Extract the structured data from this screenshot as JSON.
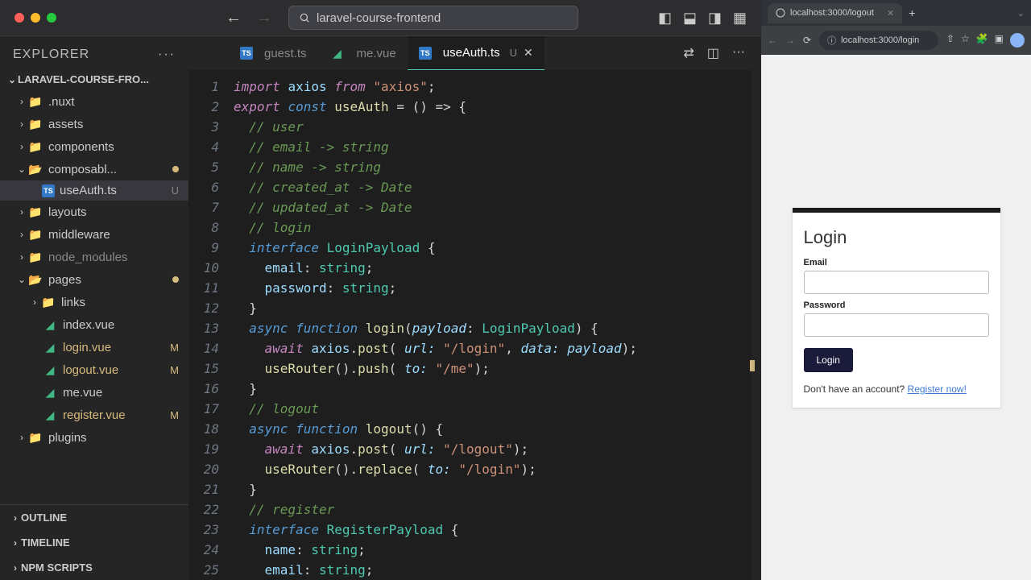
{
  "titlebar": {
    "project": "laravel-course-frontend"
  },
  "explorer": {
    "title": "EXPLORER",
    "project": "LARAVEL-COURSE-FRO...",
    "tree": {
      "nuxt": ".nuxt",
      "assets": "assets",
      "components": "components",
      "composables": "composabl...",
      "useAuth": "useAuth.ts",
      "useAuth_badge": "U",
      "layouts": "layouts",
      "middleware": "middleware",
      "node_modules": "node_modules",
      "pages": "pages",
      "links": "links",
      "index_vue": "index.vue",
      "login_vue": "login.vue",
      "logout_vue": "logout.vue",
      "me_vue": "me.vue",
      "register_vue": "register.vue",
      "plugins": "plugins",
      "m": "M"
    },
    "outline": "OUTLINE",
    "timeline": "TIMELINE",
    "npm": "NPM SCRIPTS"
  },
  "tabs": {
    "guest": "guest.ts",
    "me": "me.vue",
    "useAuth": "useAuth.ts",
    "u": "U"
  },
  "code": {
    "l1a": "import",
    "l1b": "axios",
    "l1c": "from",
    "l1d": "\"axios\"",
    "l1e": ";",
    "l2a": "export",
    "l2b": "const",
    "l2c": "useAuth",
    "l2d": " = () => {",
    "l3": "// user",
    "l4": "// email -> string",
    "l5": "// name -> string",
    "l6": "// created_at -> Date",
    "l7": "// updated_at -> Date",
    "l8": "// login",
    "l9a": "interface",
    "l9b": "LoginPayload",
    "l9c": " {",
    "l10a": "email",
    "l10b": ": ",
    "l10c": "string",
    "l10d": ";",
    "l11a": "password",
    "l11b": ": ",
    "l11c": "string",
    "l11d": ";",
    "l12": "}",
    "l13a": "async",
    "l13b": "function",
    "l13c": "login",
    "l13d": "(",
    "l13e": "payload",
    "l13f": ": ",
    "l13g": "LoginPayload",
    "l13h": ") {",
    "l14a": "await",
    "l14b": "axios",
    "l14c": ".",
    "l14d": "post",
    "l14e": "(",
    "l14f": " url: ",
    "l14g": "\"/login\"",
    "l14h": ", ",
    "l14i": " data: ",
    "l14j": "payload",
    "l14k": ");",
    "l15a": "useRouter",
    "l15b": "().",
    "l15c": "push",
    "l15d": "(",
    "l15e": " to: ",
    "l15f": "\"/me\"",
    "l15g": ");",
    "l16": "}",
    "l17": "// logout",
    "l18a": "async",
    "l18b": "function",
    "l18c": "logout",
    "l18d": "() {",
    "l19a": "await",
    "l19b": "axios",
    "l19c": ".",
    "l19d": "post",
    "l19e": "(",
    "l19f": " url: ",
    "l19g": "\"/logout\"",
    "l19h": ");",
    "l20a": "useRouter",
    "l20b": "().",
    "l20c": "replace",
    "l20d": "(",
    "l20e": " to: ",
    "l20f": "\"/login\"",
    "l20g": ");",
    "l21": "}",
    "l22": "// register",
    "l23a": "interface",
    "l23b": "RegisterPayload",
    "l23c": " {",
    "l24a": "name",
    "l24b": ": ",
    "l24c": "string",
    "l24d": ";",
    "l25a": "email",
    "l25b": ": ",
    "l25c": "string",
    "l25d": ";"
  },
  "browser": {
    "tab_title": "localhost:3000/logout",
    "url": "localhost:3000/login",
    "form": {
      "title": "Login",
      "email_label": "Email",
      "password_label": "Password",
      "button": "Login",
      "prompt": "Don't have an account? ",
      "link": "Register now!"
    }
  }
}
